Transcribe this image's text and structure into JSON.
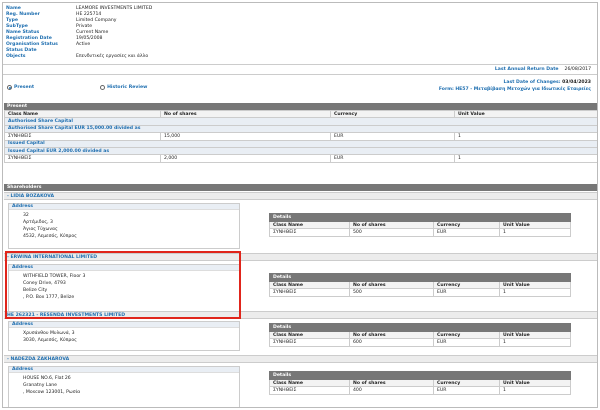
{
  "company": {
    "rows": [
      {
        "label": "Name",
        "value": "LEAMORE INVESTMENTS LIMITED"
      },
      {
        "label": "Reg. Number",
        "value": "HE 225714"
      },
      {
        "label": "Type",
        "value": "Limited Company"
      },
      {
        "label": "SubType",
        "value": "Private"
      },
      {
        "label": "Name Status",
        "value": "Current Name"
      },
      {
        "label": "Registration Date",
        "value": "19/05/2008"
      },
      {
        "label": "Organisation Status",
        "value": "Active"
      },
      {
        "label": "Status Date",
        "value": ""
      },
      {
        "label": "Objects",
        "value": "Επενδυτικές εργασίες και άλλο"
      }
    ]
  },
  "annual_return": {
    "label": "Last Annual Return Date",
    "value": "26/08/2017"
  },
  "view_toggle": {
    "present": "Present",
    "historic": "Historic Review",
    "selected": "present"
  },
  "changes": {
    "date_label": "Last Date of Changes:",
    "date_value": "03/04/2023",
    "form_label": "Form:",
    "form_value": "HE57 - Μεταβίβαση Μετοχών για Ιδιωτικές Εταιρείες"
  },
  "present": {
    "title": "Present",
    "columns": [
      "Class Name",
      "No of shares",
      "Currency",
      "Unit Value"
    ],
    "authorised_label": "Authorised Share Capital",
    "authorised_desc": "Authorised Share Capital EUR 15,000.00 divided as",
    "authorised_row": [
      "ΣΥΝΗΘΕΙΣ",
      "15,000",
      "EUR",
      "1"
    ],
    "issued_label": "Issued Capital",
    "issued_desc": "Issued Capital EUR 2,000.00 divided as",
    "issued_row": [
      "ΣΥΝΗΘΕΙΣ",
      "2,000",
      "EUR",
      "1"
    ]
  },
  "shareholders": {
    "title": "Shareholders",
    "address_label": "Address",
    "details_label": "Details",
    "columns": [
      "Class Name",
      "No of shares",
      "Currency",
      "Unit Value"
    ],
    "items": [
      {
        "name": "- LIDIA BOZAKOVA",
        "address": [
          "32",
          "Αρτέμιδος, 3",
          "Άγιος Τύχωνας",
          "4532, Λεμεσός, Κύπρος"
        ],
        "row": [
          "ΣΥΝΗΘΕΙΣ",
          "500",
          "EUR",
          "1"
        ]
      },
      {
        "name": "- ERWINA INTERNATIONAL LIMITED",
        "address": [
          "WITHFIELD TOWER, Floor 3",
          "Coney Drive, 4793",
          "Belize City",
          ", P.O. Box 1777, Belize"
        ],
        "row": [
          "ΣΥΝΗΘΕΙΣ",
          "500",
          "EUR",
          "1"
        ]
      },
      {
        "name": "HE 262321 - RESENDA INVESTMENTS LIMITED",
        "address": [
          "Χρυσάνθου Μυλωνά, 3",
          "3030, Λεμεσός, Κύπρος"
        ],
        "row": [
          "ΣΥΝΗΘΕΙΣ",
          "600",
          "EUR",
          "1"
        ]
      },
      {
        "name": "- NADEZDA ZAKHAROVA",
        "address": [
          "HOUSE NO.6, Flat 26",
          "Granatny Lane",
          ", Moscow 123001, Ρωσία"
        ],
        "row": [
          "ΣΥΝΗΘΕΙΣ",
          "400",
          "EUR",
          "1"
        ]
      }
    ]
  }
}
